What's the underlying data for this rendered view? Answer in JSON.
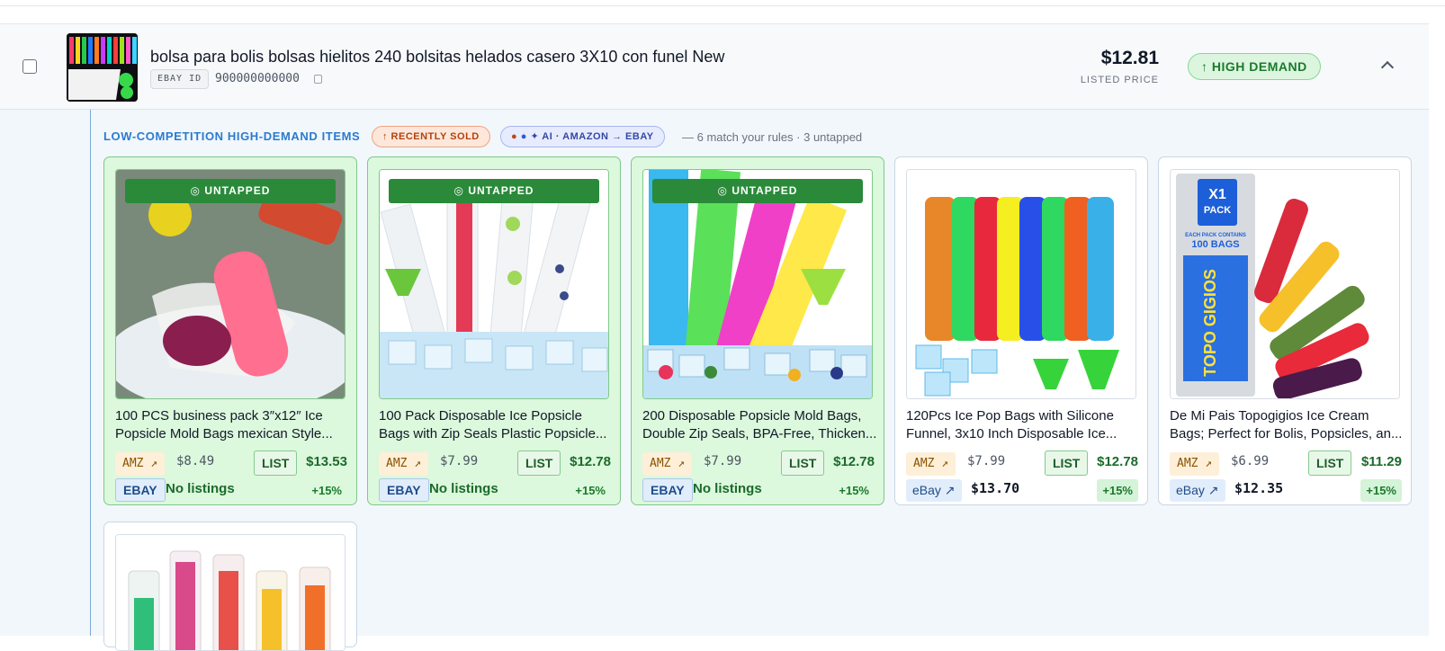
{
  "listing": {
    "title": "bolsa para bolis bolsas hielitos 240 bolsitas helados casero 3X10 con funel New",
    "id_label": "EBAY ID",
    "id_value": "900000000000",
    "price": "$12.81",
    "price_label": "LISTED PRICE",
    "demand_badge": "↑ HIGH DEMAND"
  },
  "section": {
    "heading": "LOW-COMPETITION HIGH-DEMAND ITEMS",
    "recently_sold": "↑ RECENTLY SOLD",
    "ai_dot1": "●",
    "ai_dot2": "●",
    "ai_label": "✦ AI · AMAZON → EBAY",
    "summary": "— 6 match your rules · 3 untapped"
  },
  "cards": [
    {
      "badge": "◎ UNTAPPED",
      "title_l1": "100 PCS business pack 3″x12″ Ice",
      "title_l2": "Popsicle Mold Bags mexican Style...",
      "amz_label": "AMZ ↗",
      "amz_price": "$8.49",
      "list_label": "LIST",
      "list_price": "$13.53",
      "ebay_label": "EBAY",
      "ebay_value": "No listings",
      "pct": "+15%"
    },
    {
      "badge": "◎ UNTAPPED",
      "title_l1": "100 Pack Disposable Ice Popsicle",
      "title_l2": "Bags with Zip Seals Plastic Popsicle...",
      "amz_label": "AMZ ↗",
      "amz_price": "$7.99",
      "list_label": "LIST",
      "list_price": "$12.78",
      "ebay_label": "EBAY",
      "ebay_value": "No listings",
      "pct": "+15%"
    },
    {
      "badge": "◎ UNTAPPED",
      "title_l1": "200 Disposable Popsicle Mold Bags,",
      "title_l2": "Double Zip Seals, BPA-Free, Thicken...",
      "amz_label": "AMZ ↗",
      "amz_price": "$7.99",
      "list_label": "LIST",
      "list_price": "$12.78",
      "ebay_label": "EBAY",
      "ebay_value": "No listings",
      "pct": "+15%"
    },
    {
      "title_l1": "120Pcs Ice Pop Bags with Silicone",
      "title_l2": "Funnel, 3x10 Inch Disposable Ice...",
      "amz_label": "AMZ ↗",
      "amz_price": "$7.99",
      "list_label": "LIST",
      "list_price": "$12.78",
      "ebay_label": "eBay ↗",
      "ebay_value": "$13.70",
      "pct": "+15%"
    },
    {
      "title_l1": "De Mi Pais Topogigios Ice Cream",
      "title_l2": "Bags; Perfect for Bolis, Popsicles, an...",
      "amz_label": "AMZ ↗",
      "amz_price": "$6.99",
      "list_label": "LIST",
      "list_price": "$11.29",
      "ebay_label": "eBay ↗",
      "ebay_value": "$12.35",
      "pct": "+15%",
      "pack_l1": "X1",
      "pack_l2": "PACK",
      "pack_note": "EACH PACK CONTAINS",
      "pack_count": "100 BAGS",
      "brand": "TOPO GIGIOS"
    }
  ],
  "colors": {
    "accent": "#2a7bcf",
    "untapped_bg": "#dcf8dd",
    "badge_green": "#2a8a3a",
    "demand_green": "#1b7a2c"
  }
}
